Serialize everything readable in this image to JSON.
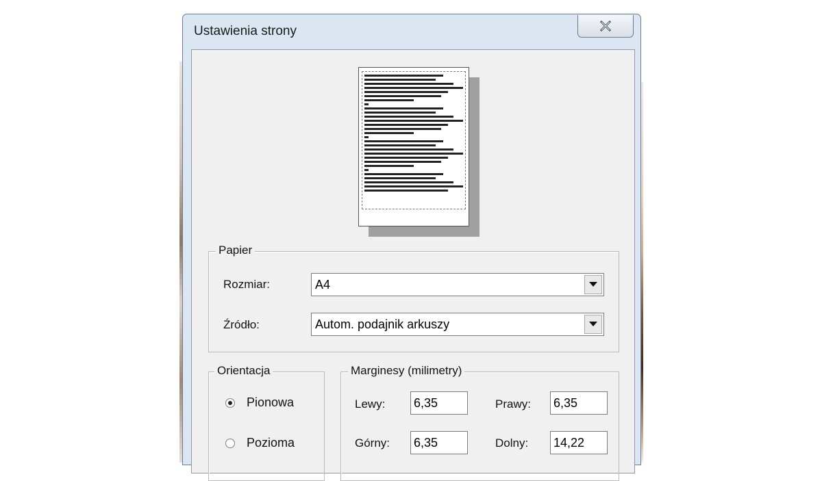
{
  "dialog": {
    "title": "Ustawienia strony",
    "close_icon": "close-icon"
  },
  "paper": {
    "group_label": "Papier",
    "size_label": "Rozmiar:",
    "size_value": "A4",
    "source_label": "Źródło:",
    "source_value": "Autom. podajnik arkuszy"
  },
  "orientation": {
    "group_label": "Orientacja",
    "portrait_label": "Pionowa",
    "landscape_label": "Pozioma",
    "selected": "portrait"
  },
  "margins": {
    "group_label": "Marginesy (milimetry)",
    "left_label": "Lewy:",
    "left_value": "6,35",
    "right_label": "Prawy:",
    "right_value": "6,35",
    "top_label": "Górny:",
    "top_value": "6,35",
    "bottom_label": "Dolny:",
    "bottom_value": "14,22"
  },
  "colors": {
    "frame": "#dce6f2",
    "client": "#f0f0f0"
  }
}
